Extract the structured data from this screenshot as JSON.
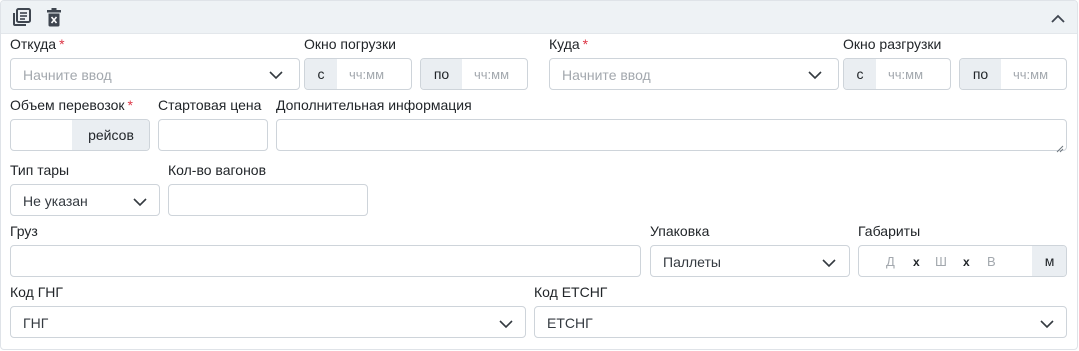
{
  "toolbar": {
    "icons": [
      "list-icon",
      "trash-icon",
      "chevron-up-icon"
    ]
  },
  "from": {
    "label": "Откуда",
    "required": "*",
    "placeholder": "Начните ввод"
  },
  "loading_window": {
    "label": "Окно погрузки",
    "from_prefix": "с",
    "from_placeholder": "чч:мм",
    "to_prefix": "по",
    "to_placeholder": "чч:мм"
  },
  "to": {
    "label": "Куда",
    "required": "*",
    "placeholder": "Начните ввод"
  },
  "unloading_window": {
    "label": "Окно разгрузки",
    "from_prefix": "с",
    "from_placeholder": "чч:мм",
    "to_prefix": "по",
    "to_placeholder": "чч:мм"
  },
  "volume": {
    "label": "Объем перевозок",
    "required": "*",
    "unit": "рейсов",
    "value": ""
  },
  "start_price": {
    "label": "Стартовая цена",
    "value": ""
  },
  "additional_info": {
    "label": "Дополнительная информация",
    "value": ""
  },
  "container_type": {
    "label": "Тип тары",
    "selected": "Не указан"
  },
  "wagons": {
    "label": "Кол-во вагонов",
    "value": ""
  },
  "cargo": {
    "label": "Груз",
    "value": ""
  },
  "packaging": {
    "label": "Упаковка",
    "selected": "Паллеты"
  },
  "dimensions": {
    "label": "Габариты",
    "length_placeholder": "Д",
    "width_placeholder": "Ш",
    "height_placeholder": "В",
    "separator": "x",
    "unit": "м"
  },
  "gng": {
    "label": "Код ГНГ",
    "selected": "ГНГ"
  },
  "etsng": {
    "label": "Код ЕТСНГ",
    "selected": "ЕТСНГ"
  }
}
